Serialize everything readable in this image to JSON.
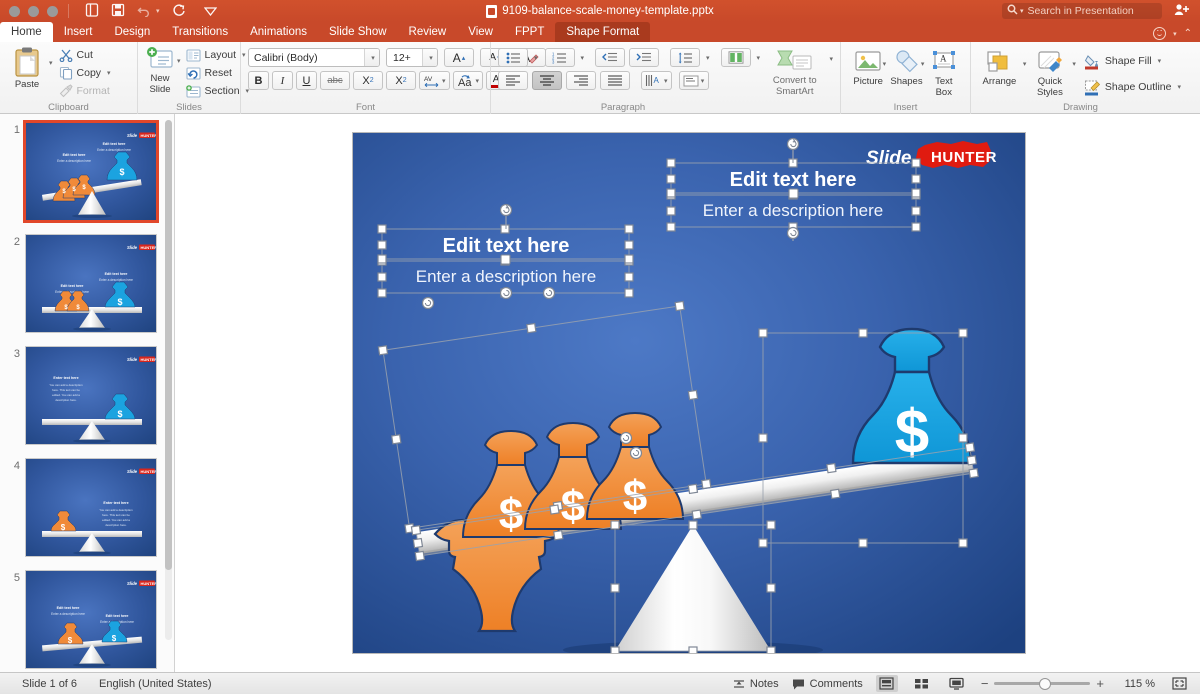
{
  "window": {
    "title": "9109-balance-scale-money-template.pptx",
    "quick_access": [
      "new-from-template-icon",
      "save-icon",
      "undo-icon",
      "redo-icon",
      "customize-icon"
    ]
  },
  "search": {
    "placeholder": "Search in Presentation",
    "value": ""
  },
  "tabs": [
    {
      "label": "Home",
      "state": "active"
    },
    {
      "label": "Insert",
      "state": "normal"
    },
    {
      "label": "Design",
      "state": "normal"
    },
    {
      "label": "Transitions",
      "state": "normal"
    },
    {
      "label": "Animations",
      "state": "normal"
    },
    {
      "label": "Slide Show",
      "state": "normal"
    },
    {
      "label": "Review",
      "state": "normal"
    },
    {
      "label": "View",
      "state": "normal"
    },
    {
      "label": "FPPT",
      "state": "normal"
    },
    {
      "label": "Shape Format",
      "state": "contextual"
    }
  ],
  "ribbon": {
    "clipboard": {
      "label": "Clipboard",
      "paste": "Paste",
      "cut": "Cut",
      "copy": "Copy",
      "format": "Format"
    },
    "slides": {
      "label": "Slides",
      "new_slide": "New\nSlide",
      "new_slide_line1": "New",
      "new_slide_line2": "Slide",
      "layout": "Layout",
      "reset": "Reset",
      "section": "Section"
    },
    "font": {
      "label": "Font",
      "family": "Calibri (Body)",
      "size": "12+",
      "grow": "A",
      "shrink": "A",
      "clear_formatting": "A",
      "bold": "B",
      "italic": "I",
      "underline": "U",
      "strikethrough": "abc",
      "superscript": "X",
      "subscript": "X",
      "spacing": "AV",
      "change_case": "Aa",
      "font_color": "A"
    },
    "paragraph": {
      "label": "Paragraph",
      "convert_to_smartart_line1": "Convert to",
      "convert_to_smartart_line2": "SmartArt"
    },
    "insert": {
      "label": "Insert",
      "picture": "Picture",
      "shapes": "Shapes",
      "text_box_line1": "Text",
      "text_box_line2": "Box"
    },
    "drawing": {
      "label": "Drawing",
      "arrange": "Arrange",
      "quick_styles_line1": "Quick",
      "quick_styles_line2": "Styles",
      "shape_fill": "Shape Fill",
      "shape_outline": "Shape Outline"
    }
  },
  "thumbnails": [
    {
      "number": "1",
      "selected": true,
      "variant": "tilted-3-1"
    },
    {
      "number": "2",
      "selected": false,
      "variant": "level-2-1"
    },
    {
      "number": "3",
      "selected": false,
      "variant": "level-0-1"
    },
    {
      "number": "4",
      "selected": false,
      "variant": "level-1-0"
    },
    {
      "number": "5",
      "selected": false,
      "variant": "tilted-1-1"
    }
  ],
  "slide": {
    "logo": {
      "word1": "Slide",
      "word2": "HUNTER"
    },
    "left_text": {
      "title": "Edit text here",
      "description": "Enter a description here"
    },
    "right_text": {
      "title": "Edit text here",
      "description": "Enter a description here"
    },
    "money_symbol": "$",
    "orange_bags": 3,
    "blue_bags": 1,
    "colors": {
      "orange_bag": "#f08a39",
      "blue_bag": "#1ba3e0",
      "slide_bg": "#2a4f93",
      "beam": "#f2f2f2",
      "accent_red": "#e1472a"
    }
  },
  "status": {
    "slide_counter": "Slide 1 of 6",
    "language": "English (United States)",
    "notes": "Notes",
    "comments": "Comments",
    "zoom_value": "115 %",
    "zoom_minus": "−",
    "zoom_plus": "+",
    "views": [
      "normal-view",
      "slide-sorter-view",
      "slideshow-view"
    ],
    "fit_label": "fit-to-window"
  }
}
